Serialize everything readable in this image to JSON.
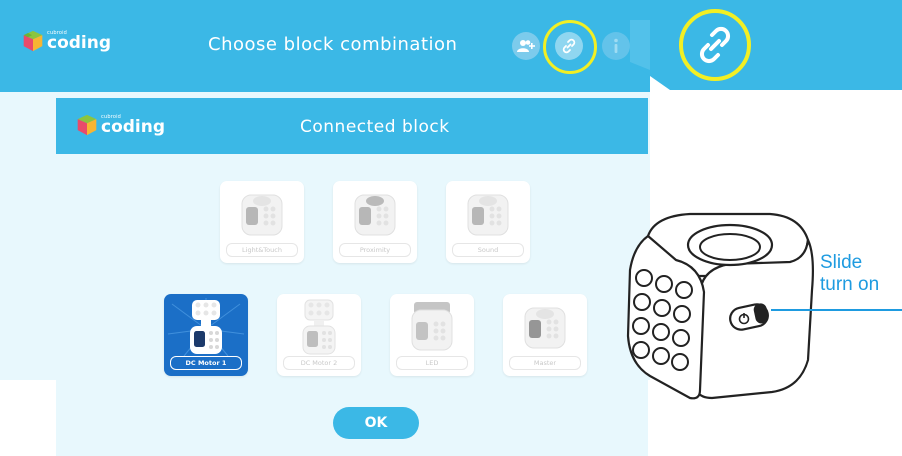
{
  "back_screen": {
    "brand_small": "cubroid",
    "brand_name": "coding",
    "title": "Choose block combination",
    "icons": [
      "add-user-icon",
      "link-icon",
      "info-icon"
    ]
  },
  "dialog": {
    "brand_small": "cubroid",
    "brand_name": "coding",
    "title": "Connected block",
    "blocks_row1": [
      {
        "label": "Light&Touch",
        "selected": false
      },
      {
        "label": "Proximity",
        "selected": false
      },
      {
        "label": "Sound",
        "selected": false
      }
    ],
    "blocks_row2": [
      {
        "label": "DC Motor 1",
        "selected": true
      },
      {
        "label": "DC Motor 2",
        "selected": false
      },
      {
        "label": "LED",
        "selected": false
      },
      {
        "label": "Master",
        "selected": false
      }
    ],
    "ok_label": "OK"
  },
  "callout": {
    "line1": "Slide",
    "line2": "turn on"
  },
  "colors": {
    "header_blue": "#3bb8e6",
    "background": "#e8f8fd",
    "selected": "#1b6fc7",
    "highlight": "#f2ef24",
    "callout_text": "#1e9be0"
  }
}
